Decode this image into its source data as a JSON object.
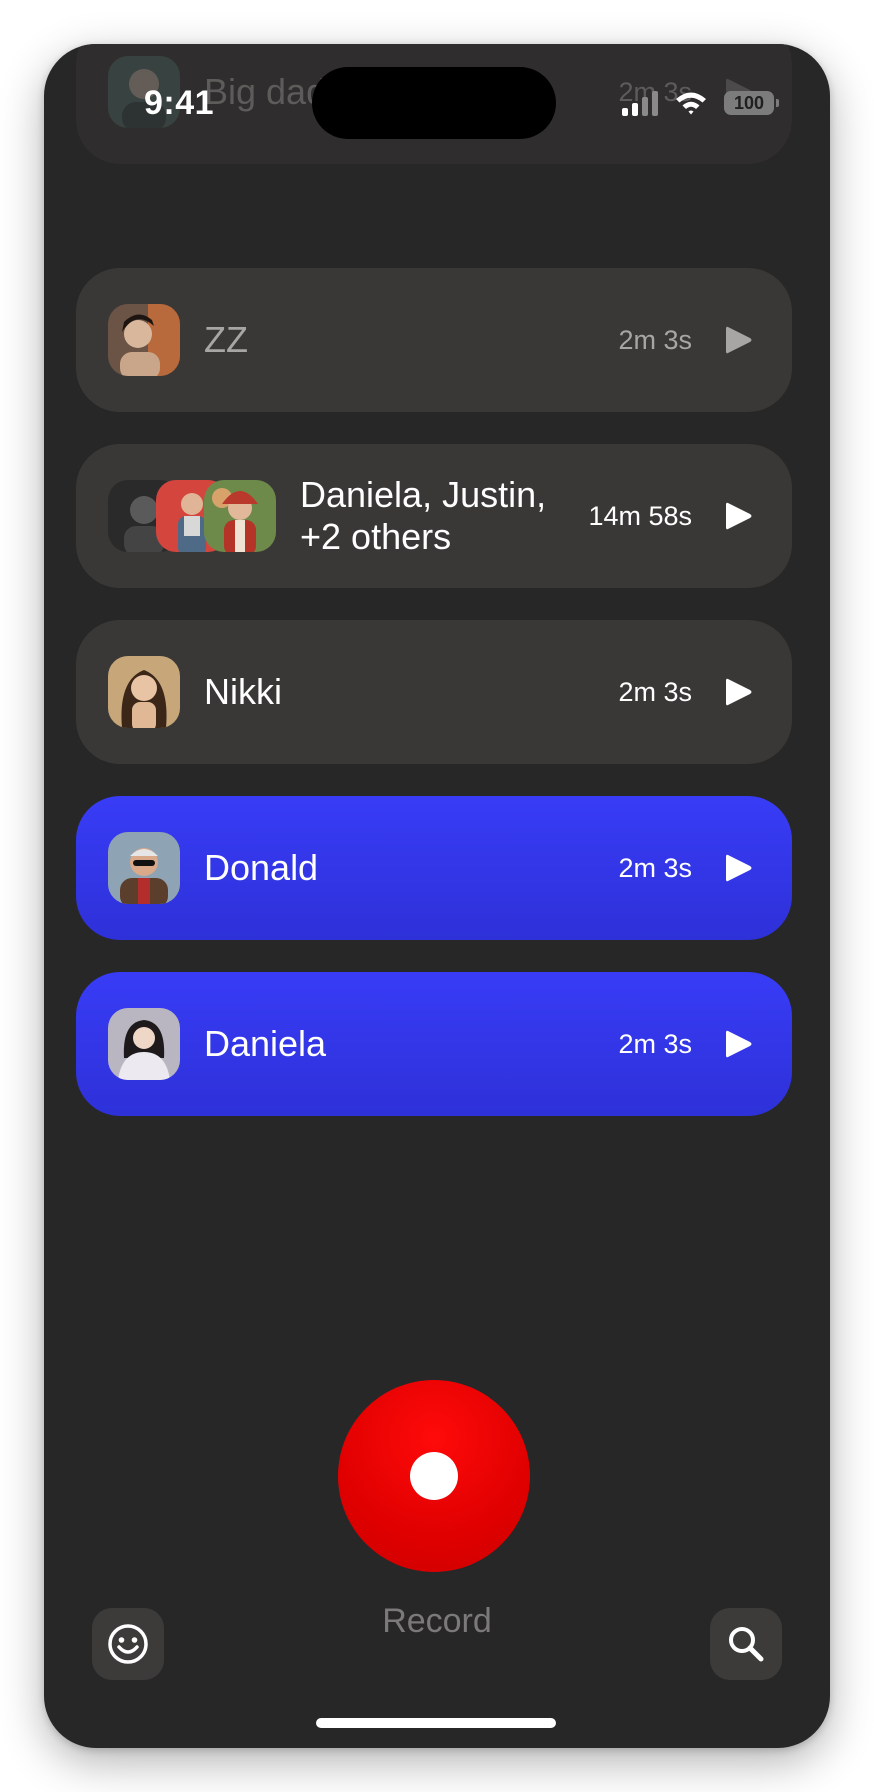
{
  "status_bar": {
    "time": "9:41",
    "battery": "100"
  },
  "conversations": [
    {
      "name": "Big daddy",
      "duration": "2m 3s"
    },
    {
      "name": "ZZ",
      "duration": "2m 3s"
    },
    {
      "name": "Daniela, Justin, +2 others",
      "name_line1": "Daniela, Justin,",
      "name_line2": "+2 others",
      "duration": "14m 58s"
    },
    {
      "name": "Nikki",
      "duration": "2m 3s"
    },
    {
      "name": "Donald",
      "duration": "2m 3s"
    },
    {
      "name": "Daniela",
      "duration": "2m 3s"
    }
  ],
  "record": {
    "label": "Record"
  },
  "colors": {
    "accent_blue": "#3538EE",
    "record_red": "#E00000",
    "background": "#272727"
  },
  "icons": {
    "left_button": "smiley-icon",
    "right_button": "search-icon",
    "row_action": "play-icon"
  }
}
